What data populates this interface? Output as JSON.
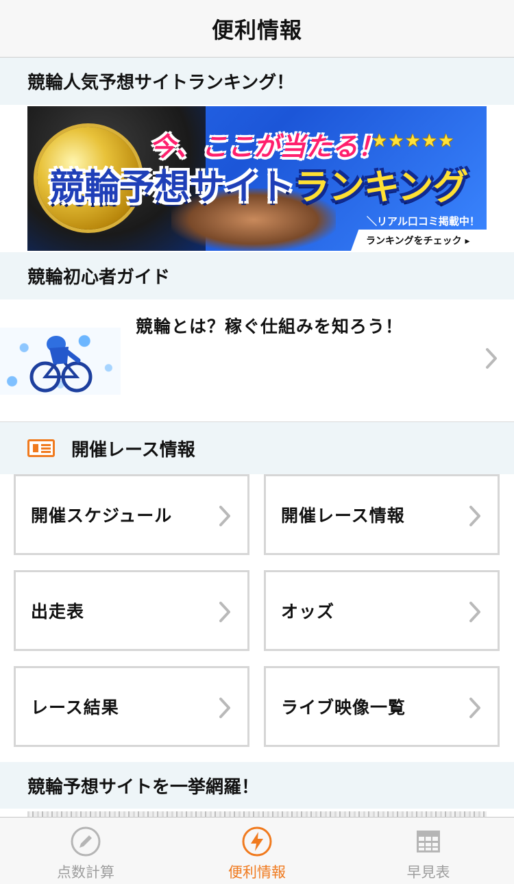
{
  "header": {
    "title": "便利情報"
  },
  "sections": {
    "ranking": {
      "title": "競輪人気予想サイトランキング！"
    },
    "guide": {
      "title": "競輪初心者ガイド"
    },
    "race_info": {
      "title": "開催レース情報"
    },
    "sites": {
      "title": "競輪予想サイトを一挙網羅！"
    }
  },
  "banner": {
    "headline": "今、ここが当たる！",
    "stars": "★★★★★",
    "main_part1": "競輪予想",
    "main_part2": "サイト",
    "main_part3": "ランキング",
    "review": "＼リアル口コミ掲載中！／",
    "check": "ランキングをチェック ▸"
  },
  "guide_item": {
    "text": "競輪とは？稼ぐ仕組みを知ろう！"
  },
  "race_buttons": [
    {
      "label": "開催スケジュール"
    },
    {
      "label": "開催レース情報"
    },
    {
      "label": "出走表"
    },
    {
      "label": "オッズ"
    },
    {
      "label": "レース結果"
    },
    {
      "label": "ライブ映像一覧"
    }
  ],
  "tabs": [
    {
      "label": "点数計算",
      "icon": "pencil-icon",
      "active": false
    },
    {
      "label": "便利情報",
      "icon": "lightning-icon",
      "active": true
    },
    {
      "label": "早見表",
      "icon": "table-icon",
      "active": false
    }
  ],
  "colors": {
    "accent": "#f07a1e",
    "section_bg": "#eef5f8",
    "inactive": "#9d9d9d",
    "chevron": "#b9b9b9"
  }
}
